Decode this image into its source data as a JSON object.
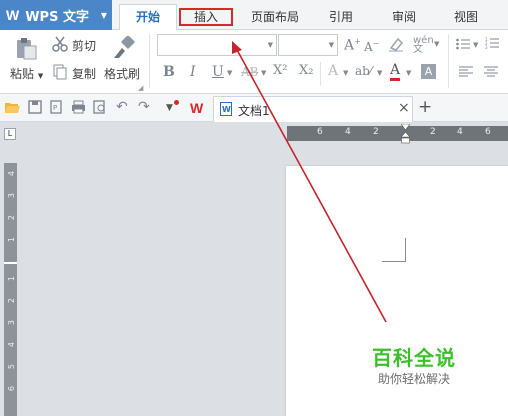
{
  "app": {
    "name": "WPS 文字",
    "logo_letter": "W"
  },
  "tabs": [
    "开始",
    "插入",
    "页面布局",
    "引用",
    "审阅",
    "视图"
  ],
  "active_tab": "开始",
  "highlighted_tab": "插入",
  "clipboard": {
    "paste": "粘贴",
    "cut": "剪切",
    "copy": "复制",
    "format_painter": "格式刷"
  },
  "font": {
    "name_value": "",
    "size_value": ""
  },
  "font_buttons": {
    "bold": "B",
    "italic": "I",
    "underline": "U",
    "superscript": "X²",
    "subscript": "X₂",
    "font_color": "A"
  },
  "document_tab": {
    "title": "文档1",
    "close": "×",
    "new": "+"
  },
  "hruler": {
    "labels": [
      "6",
      "4",
      "2",
      "2",
      "4",
      "6"
    ]
  },
  "vruler": {
    "labels": [
      "4",
      "3",
      "2",
      "1",
      "1",
      "2",
      "3",
      "4",
      "5",
      "6"
    ]
  },
  "watermark": {
    "title": "百科全说",
    "subtitle": "助你轻松解决"
  },
  "colors": {
    "brand": "#4a86c8",
    "accent": "#d62828",
    "active_tab_text": "#2a6fbd",
    "watermark": "#3cbf2a"
  }
}
